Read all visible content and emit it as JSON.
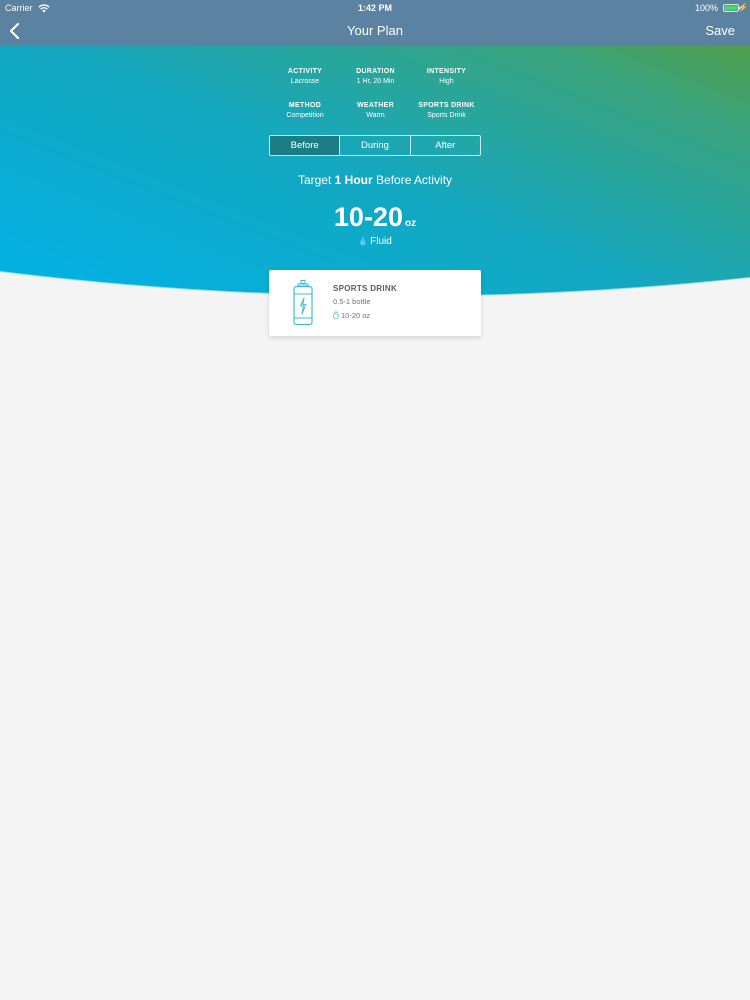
{
  "status_bar": {
    "carrier": "Carrier",
    "time": "1:42 PM",
    "battery": "100%"
  },
  "nav": {
    "title": "Your Plan",
    "save_label": "Save"
  },
  "summary": [
    {
      "label": "ACTIVITY",
      "value": "Lacrosse"
    },
    {
      "label": "DURATION",
      "value": "1 Hr, 20 Min"
    },
    {
      "label": "INTENSITY",
      "value": "High"
    },
    {
      "label": "METHOD",
      "value": "Competition"
    },
    {
      "label": "WEATHER",
      "value": "Warm"
    },
    {
      "label": "SPORTS DRINK",
      "value": "Sports Drink"
    }
  ],
  "tabs": [
    {
      "label": "Before",
      "active": true
    },
    {
      "label": "During",
      "active": false
    },
    {
      "label": "After",
      "active": false
    }
  ],
  "target": {
    "prefix": "Target",
    "bold": "1 Hour",
    "suffix": "Before Activity"
  },
  "amount": {
    "value": "10-20",
    "unit": "oz",
    "label": "Fluid"
  },
  "card": {
    "title": "SPORTS DRINK",
    "quantity": "0.5-1 bottle",
    "ounces": "10-20 oz",
    "icon": "sports-drink-bottle-icon"
  },
  "colors": {
    "nav_bar": "#5b83a1",
    "gradient_blue": "#00b2e6",
    "gradient_green": "#5d9d32",
    "active_tab": "#1c7e84",
    "accent": "#3fbdd0",
    "background": "#f4f4f5"
  }
}
